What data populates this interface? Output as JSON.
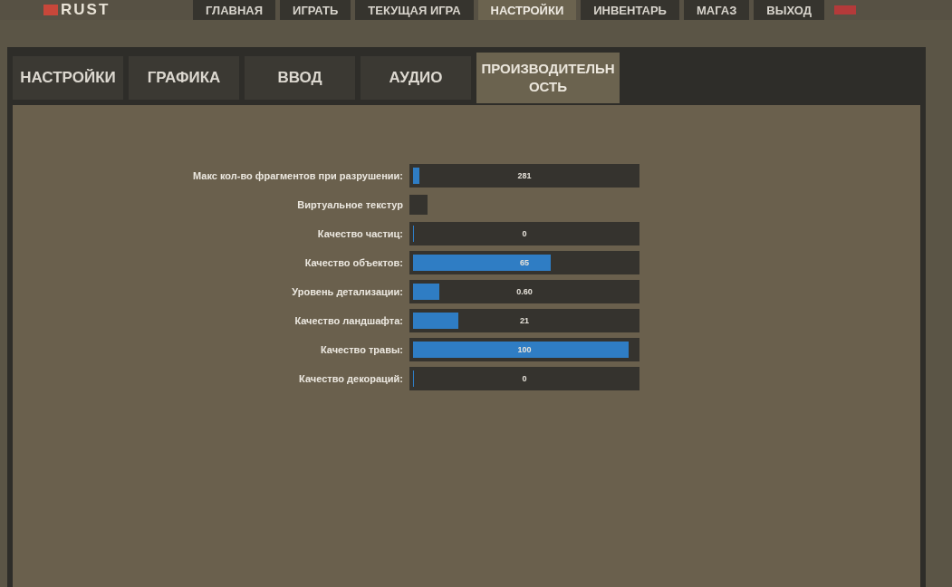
{
  "logo": "RUST",
  "nav": [
    {
      "label": "ГЛАВНАЯ",
      "selected": false
    },
    {
      "label": "ИГРАТЬ",
      "selected": false
    },
    {
      "label": "ТЕКУЩАЯ ИГРА",
      "selected": false
    },
    {
      "label": "НАСТРОЙКИ",
      "selected": true
    },
    {
      "label": "ИНВЕНТАРЬ",
      "selected": false
    },
    {
      "label": "МАГАЗ",
      "selected": false
    },
    {
      "label": "ВЫХОД",
      "selected": false
    }
  ],
  "tabs": [
    {
      "label": "НАСТРОЙКИ",
      "selected": false
    },
    {
      "label": "ГРАФИКА",
      "selected": false
    },
    {
      "label": "ВВОД",
      "selected": false
    },
    {
      "label": "АУДИО",
      "selected": false
    },
    {
      "label": "ПРОИЗВОДИТЕЛЬН ОСТЬ",
      "selected": true
    }
  ],
  "settings": [
    {
      "kind": "slider",
      "label": "Макс кол-во фрагментов при разрушении:",
      "level": 0.03,
      "value": "281"
    },
    {
      "kind": "checkbox",
      "label": "Виртуальное текстур",
      "checked": false
    },
    {
      "kind": "slider",
      "label": "Качество частиц:",
      "level": 0,
      "value": "0"
    },
    {
      "kind": "slider",
      "label": "Качество объектов:",
      "level": 0.64,
      "value": "65"
    },
    {
      "kind": "slider",
      "label": "Уровень детализации:",
      "level": 0.12,
      "value": "0.60"
    },
    {
      "kind": "slider",
      "label": "Качество ландшафта:",
      "level": 0.21,
      "value": "21"
    },
    {
      "kind": "slider",
      "label": "Качество травы:",
      "level": 1,
      "value": "100"
    },
    {
      "kind": "slider",
      "label": "Качество декораций:",
      "level": 0,
      "value": "0"
    }
  ]
}
